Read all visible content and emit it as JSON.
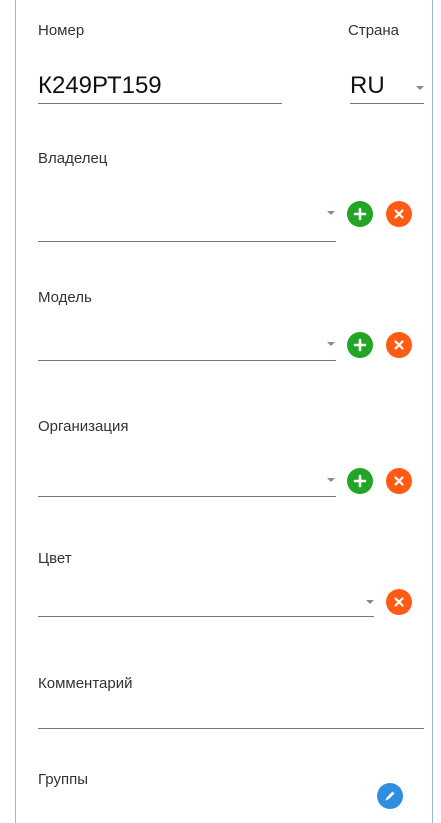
{
  "number": {
    "label": "Номер",
    "value": "К249РТ159"
  },
  "country": {
    "label": "Страна",
    "value": "RU"
  },
  "owner": {
    "label": "Владелец",
    "value": ""
  },
  "model": {
    "label": "Модель",
    "value": ""
  },
  "organization": {
    "label": "Организация",
    "value": ""
  },
  "color": {
    "label": "Цвет",
    "value": ""
  },
  "comment": {
    "label": "Комментарий",
    "value": ""
  },
  "groups": {
    "label": "Группы"
  },
  "icons": {
    "add": "plus-icon",
    "remove": "close-icon",
    "edit": "pencil-icon",
    "dropdown": "chevron-down-icon"
  },
  "colors": {
    "add": "#22a425",
    "remove": "#ff5b14",
    "edit": "#2f8ee0",
    "border": "#9db8d9"
  }
}
